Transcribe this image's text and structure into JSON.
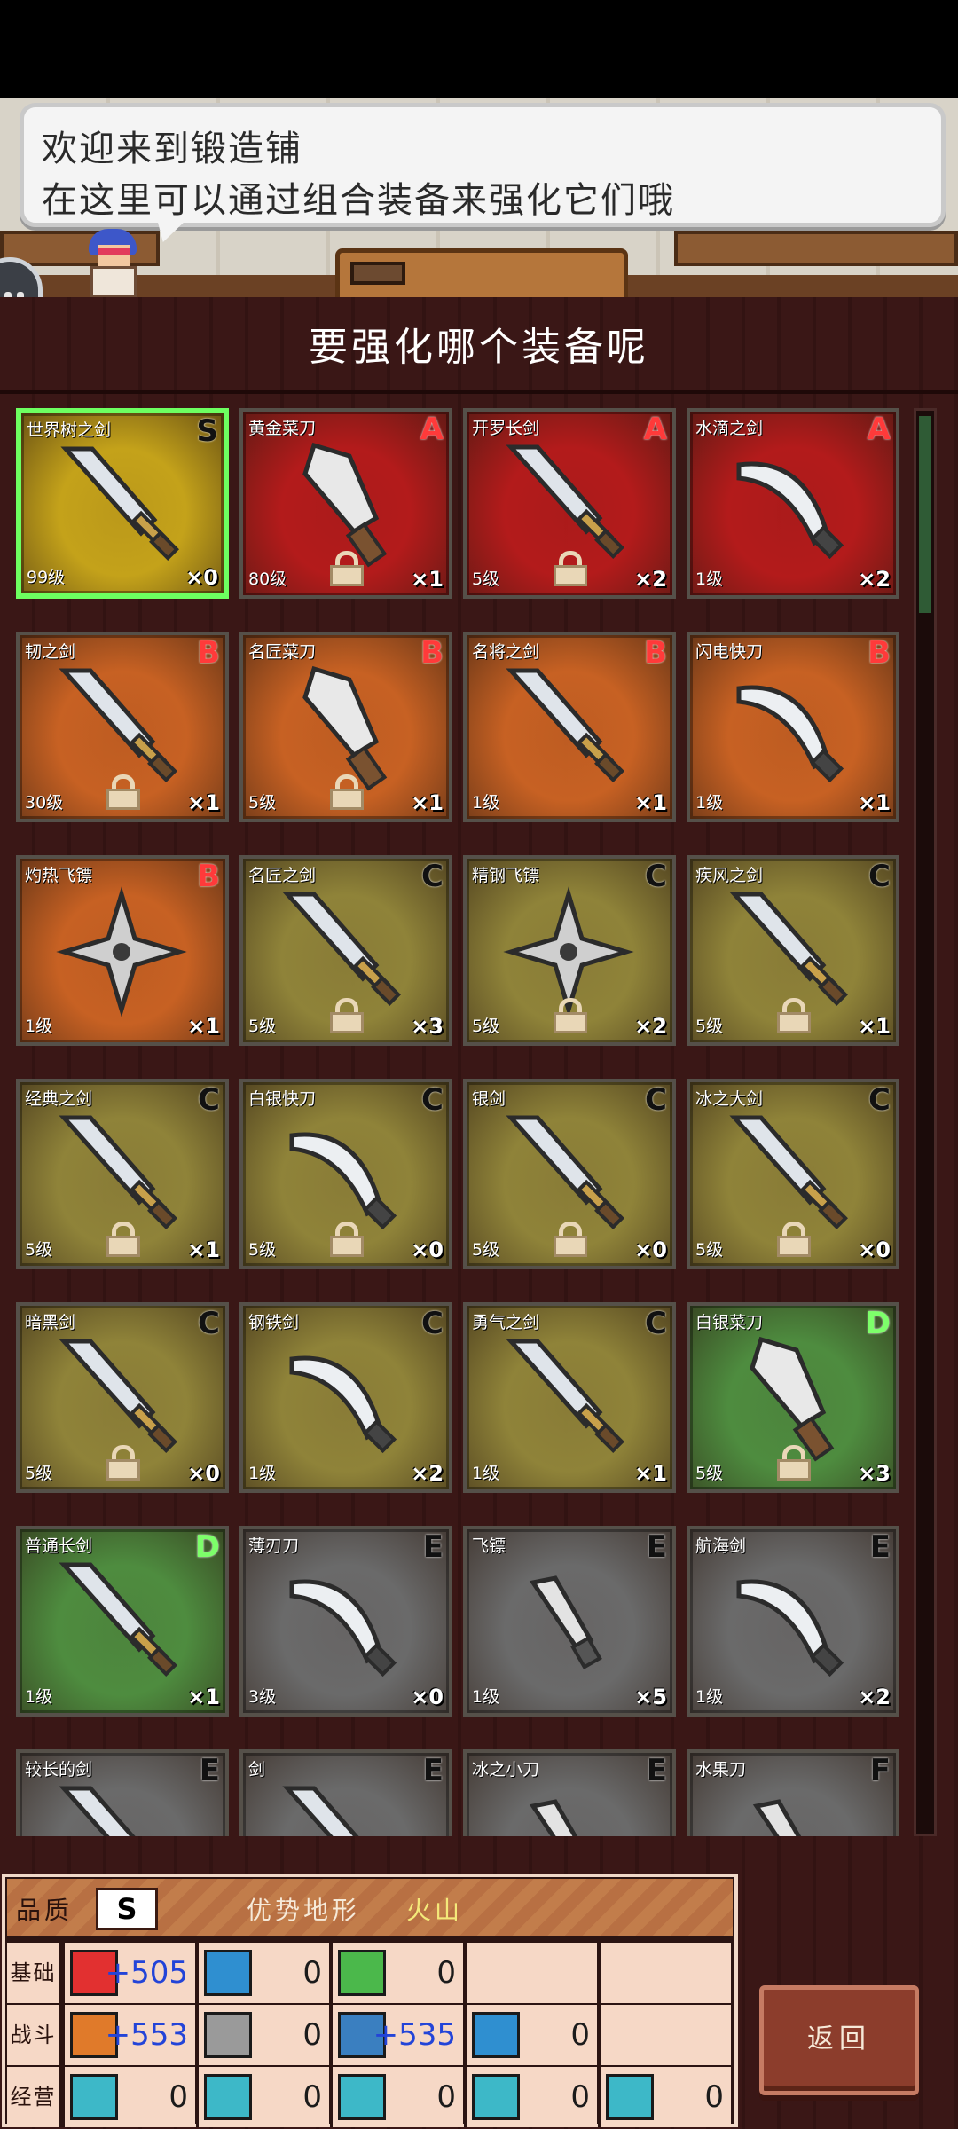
{
  "speech": {
    "line1": "欢迎来到锻造铺",
    "line2": "在这里可以通过组合装备来强化它们哦"
  },
  "panel_title": "要强化哪个装备呢",
  "colors": {
    "rank_S": "#111111",
    "rank_A": "#ff3a3a",
    "rank_B": "#ff3a3a",
    "rank_C": "#111111",
    "rank_D": "#7dff6a",
    "rank_E": "#111111",
    "rank_F": "#111111",
    "bg_S": "#c4a21a",
    "bg_A": "#b31b1b",
    "bg_B": "#c76123",
    "bg_C": "#8f8339",
    "bg_D": "#4e8c3f",
    "bg_E": "#6a6a6a",
    "bg_F": "#6a6a6a"
  },
  "items": [
    {
      "name": "世界树之剑",
      "rank": "S",
      "level": "99级",
      "count": "×0",
      "selected": true,
      "icon": "sword-icon",
      "locked": false
    },
    {
      "name": "黄金菜刀",
      "rank": "A",
      "level": "80级",
      "count": "×1",
      "icon": "cleaver-icon",
      "locked": true
    },
    {
      "name": "开罗长剑",
      "rank": "A",
      "level": "5级",
      "count": "×2",
      "icon": "sword-icon",
      "locked": true
    },
    {
      "name": "水滴之剑",
      "rank": "A",
      "level": "1级",
      "count": "×2",
      "icon": "curved-blade-icon",
      "locked": false
    },
    {
      "name": "韧之剑",
      "rank": "B",
      "level": "30级",
      "count": "×1",
      "icon": "sword-icon",
      "locked": true
    },
    {
      "name": "名匠菜刀",
      "rank": "B",
      "level": "5级",
      "count": "×1",
      "icon": "cleaver-icon",
      "locked": true
    },
    {
      "name": "名将之剑",
      "rank": "B",
      "level": "1级",
      "count": "×1",
      "icon": "sword-icon",
      "locked": false
    },
    {
      "name": "闪电快刀",
      "rank": "B",
      "level": "1级",
      "count": "×1",
      "icon": "curved-blade-icon",
      "locked": false
    },
    {
      "name": "灼热飞镖",
      "rank": "B",
      "level": "1级",
      "count": "×1",
      "icon": "shuriken-icon",
      "locked": false
    },
    {
      "name": "名匠之剑",
      "rank": "C",
      "level": "5级",
      "count": "×3",
      "icon": "sword-icon",
      "locked": true
    },
    {
      "name": "精钢飞镖",
      "rank": "C",
      "level": "5级",
      "count": "×2",
      "icon": "shuriken-icon",
      "locked": true
    },
    {
      "name": "疾风之剑",
      "rank": "C",
      "level": "5级",
      "count": "×1",
      "icon": "sword-icon",
      "locked": true
    },
    {
      "name": "经典之剑",
      "rank": "C",
      "level": "5级",
      "count": "×1",
      "icon": "sword-icon",
      "locked": true
    },
    {
      "name": "白银快刀",
      "rank": "C",
      "level": "5级",
      "count": "×0",
      "icon": "curved-blade-icon",
      "locked": true
    },
    {
      "name": "银剑",
      "rank": "C",
      "level": "5级",
      "count": "×0",
      "icon": "sword-icon",
      "locked": true
    },
    {
      "name": "冰之大剑",
      "rank": "C",
      "level": "5级",
      "count": "×0",
      "icon": "sword-icon",
      "locked": true
    },
    {
      "name": "暗黑剑",
      "rank": "C",
      "level": "5级",
      "count": "×0",
      "icon": "sword-icon",
      "locked": true
    },
    {
      "name": "钢铁剑",
      "rank": "C",
      "level": "1级",
      "count": "×2",
      "icon": "curved-blade-icon",
      "locked": false
    },
    {
      "name": "勇气之剑",
      "rank": "C",
      "level": "1级",
      "count": "×1",
      "icon": "sword-icon",
      "locked": false
    },
    {
      "name": "白银菜刀",
      "rank": "D",
      "level": "5级",
      "count": "×3",
      "icon": "cleaver-icon",
      "locked": true
    },
    {
      "name": "普通长剑",
      "rank": "D",
      "level": "1级",
      "count": "×1",
      "icon": "sword-icon",
      "locked": false
    },
    {
      "name": "薄刃刀",
      "rank": "E",
      "level": "3级",
      "count": "×0",
      "icon": "curved-blade-icon",
      "locked": false
    },
    {
      "name": "飞镖",
      "rank": "E",
      "level": "1级",
      "count": "×5",
      "icon": "dagger-icon",
      "locked": false
    },
    {
      "name": "航海剑",
      "rank": "E",
      "level": "1级",
      "count": "×2",
      "icon": "curved-blade-icon",
      "locked": false
    },
    {
      "name": "较长的剑",
      "rank": "E",
      "level": "",
      "count": "",
      "icon": "sword-icon",
      "locked": false
    },
    {
      "name": "剑",
      "rank": "E",
      "level": "",
      "count": "",
      "icon": "sword-icon",
      "locked": false
    },
    {
      "name": "冰之小刀",
      "rank": "E",
      "level": "",
      "count": "",
      "icon": "dagger-icon",
      "locked": false
    },
    {
      "name": "水果刀",
      "rank": "F",
      "level": "",
      "count": "",
      "icon": "dagger-icon",
      "locked": false
    }
  ],
  "stats": {
    "quality_label": "品质",
    "quality_value": "S",
    "terrain_label": "优势地形",
    "terrain_value": "火山",
    "rows": [
      {
        "label": "基础",
        "cells": [
          {
            "icon": "heart-icon",
            "value": "+505",
            "blue": true,
            "bg": "#e23030"
          },
          {
            "icon": "potion-icon",
            "value": "0",
            "blue": false,
            "bg": "#2f8fd0"
          },
          {
            "icon": "muscle-icon",
            "value": "0",
            "blue": false,
            "bg": "#4bb84b"
          },
          {
            "icon": "",
            "value": "",
            "blue": false,
            "bg": ""
          },
          {
            "icon": "",
            "value": "",
            "blue": false,
            "bg": ""
          }
        ]
      },
      {
        "label": "战斗",
        "cells": [
          {
            "icon": "sword-stat-icon",
            "value": "+553",
            "blue": true,
            "bg": "#e07a2a"
          },
          {
            "icon": "shield-icon",
            "value": "0",
            "blue": false,
            "bg": "#9a9a9a"
          },
          {
            "icon": "arrows-icon",
            "value": "+535",
            "blue": true,
            "bg": "#3a7fc0"
          },
          {
            "icon": "star-icon",
            "value": "0",
            "blue": false,
            "bg": "#2f8fd0"
          },
          {
            "icon": "",
            "value": "",
            "blue": false,
            "bg": ""
          }
        ]
      },
      {
        "label": "经营",
        "cells": [
          {
            "icon": "book-icon",
            "value": "0",
            "blue": false,
            "bg": "#3db8c8"
          },
          {
            "icon": "hammer-icon",
            "value": "0",
            "blue": false,
            "bg": "#3db8c8"
          },
          {
            "icon": "shovel-icon",
            "value": "0",
            "blue": false,
            "bg": "#3db8c8"
          },
          {
            "icon": "chest-icon",
            "value": "0",
            "blue": false,
            "bg": "#3db8c8"
          },
          {
            "icon": "boot-icon",
            "value": "0",
            "blue": false,
            "bg": "#3db8c8"
          }
        ]
      }
    ]
  },
  "back_label": "返回"
}
